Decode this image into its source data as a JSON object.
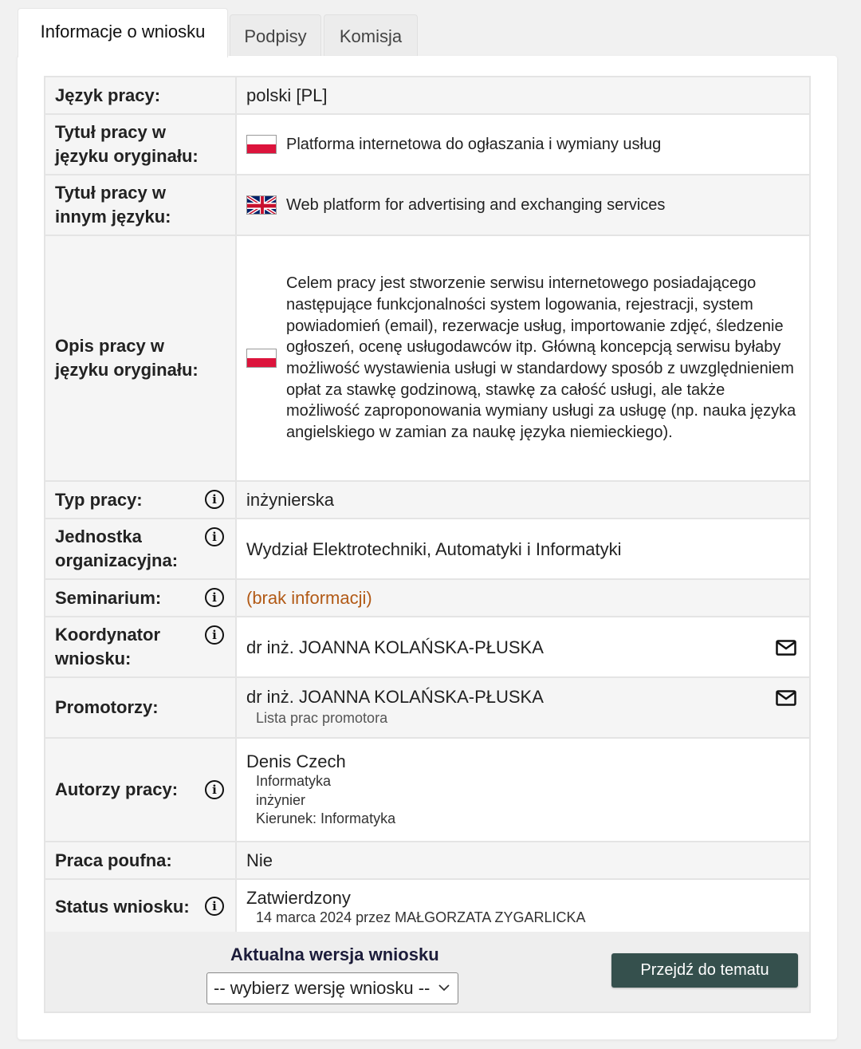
{
  "tabs": [
    "Informacje o wniosku",
    "Podpisy",
    "Komisja"
  ],
  "rows": {
    "jezyk": {
      "label": "Język pracy:",
      "value": "polski [PL]"
    },
    "tytul_org": {
      "label": "Tytuł pracy w języku oryginału:",
      "value": "Platforma internetowa do ogłaszania i wymiany usług"
    },
    "tytul_inny": {
      "label": "Tytuł pracy w innym języku:",
      "value": "Web platform for advertising and exchanging services"
    },
    "opis": {
      "label": "Opis pracy w języku oryginału:",
      "value": "Celem pracy jest stworzenie serwisu internetowego posiadającego następujące funkcjonalności system logowania, rejestracji, system powiadomień (email), rezerwacje usług, importowanie zdjęć, śledzenie ogłoszeń, ocenę usługodawców itp. Główną koncepcją serwisu byłaby możliwość wystawienia usługi w standardowy sposób z uwzględnieniem opłat za stawkę godzinową, stawkę za całość usługi, ale także możliwość zaproponowania wymiany usługi za usługę (np. nauka języka angielskiego w zamian za naukę języka niemieckiego)."
    },
    "typ": {
      "label": "Typ pracy:",
      "value": "inżynierska"
    },
    "jednostka": {
      "label": "Jednostka organizacyjna:",
      "value": "Wydział Elektrotechniki, Automatyki i Informatyki"
    },
    "seminarium": {
      "label": "Seminarium:",
      "value": "(brak informacji)"
    },
    "koordynator": {
      "label": "Koordynator wniosku:",
      "value": "dr inż. JOANNA KOLAŃSKA-PŁUSKA"
    },
    "promotorzy": {
      "label": "Promotorzy:",
      "value": "dr inż. JOANNA KOLAŃSKA-PŁUSKA",
      "link": "Lista prac promotora"
    },
    "autorzy": {
      "label": "Autorzy pracy:",
      "name": "Denis Czech",
      "field": "Informatyka",
      "degree": "inżynier",
      "kierunek": "Kierunek: Informatyka"
    },
    "poufna": {
      "label": "Praca poufna:",
      "value": "Nie"
    },
    "status": {
      "label": "Status wniosku:",
      "value": "Zatwierdzony",
      "detail": "14 marca 2024 przez MAŁGORZATA ZYGARLICKA"
    }
  },
  "footer": {
    "version_label": "Aktualna wersja wniosku",
    "version_select": "-- wybierz wersję wniosku --",
    "go_button": "Przejdź do tematu"
  },
  "icons": {
    "info": "info-circle-icon",
    "mail": "mail-icon",
    "flag_pl": "flag-pl-icon",
    "flag_gb": "flag-gb-icon"
  }
}
